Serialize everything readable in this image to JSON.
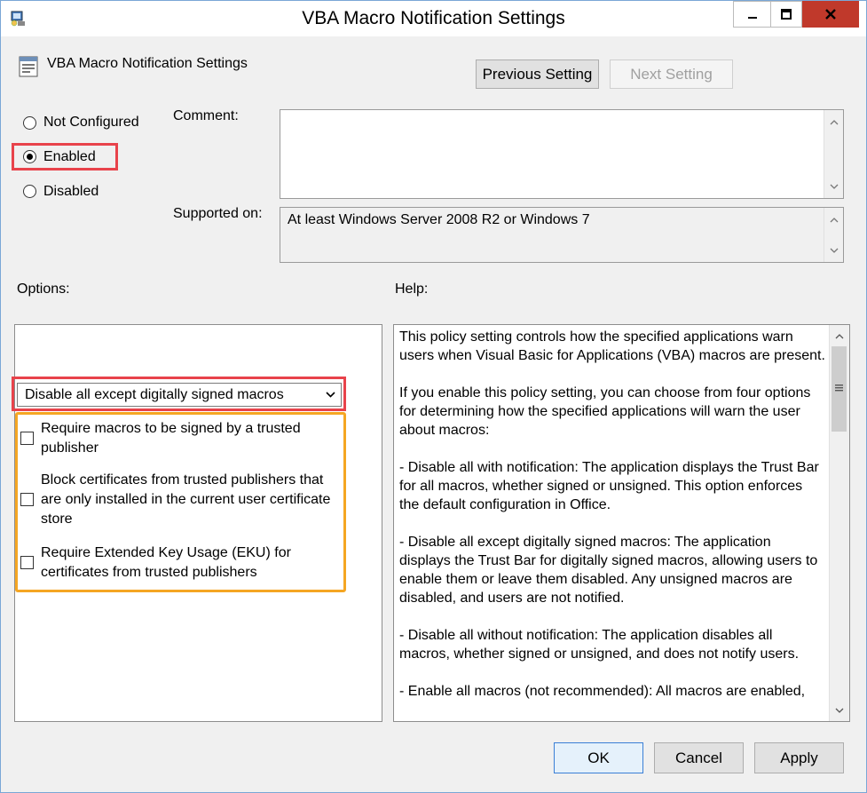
{
  "window": {
    "title": "VBA Macro Notification Settings"
  },
  "header": {
    "setting_name": "VBA Macro Notification Settings",
    "previous_label": "Previous Setting",
    "next_label": "Next Setting"
  },
  "state": {
    "options": [
      "Not Configured",
      "Enabled",
      "Disabled"
    ],
    "selected": "Enabled"
  },
  "comment": {
    "label": "Comment:",
    "value": ""
  },
  "supported": {
    "label": "Supported on:",
    "value": "At least Windows Server 2008 R2 or Windows 7"
  },
  "options_panel": {
    "label": "Options:",
    "dropdown_value": "Disable all except digitally signed macros",
    "checkboxes": [
      {
        "label": "Require macros to be signed by a trusted publisher",
        "checked": false
      },
      {
        "label": "Block certificates from trusted publishers that are only installed in the current user certificate store",
        "checked": false
      },
      {
        "label": "Require Extended Key Usage (EKU) for certificates from trusted publishers",
        "checked": false
      }
    ]
  },
  "help_panel": {
    "label": "Help:",
    "paragraphs": [
      "This policy setting controls how the specified applications warn users when Visual Basic for Applications (VBA) macros are present.",
      "If you enable this policy setting, you can choose from four options for determining how the specified applications will warn the user about macros:",
      "- Disable all with notification:  The application displays the Trust Bar for all macros, whether signed or unsigned. This option enforces the default configuration in Office.",
      "- Disable all except digitally signed macros: The application displays the Trust Bar for digitally signed macros, allowing users to enable them or leave them disabled. Any unsigned macros are disabled, and users are not notified.",
      "- Disable all without notification: The application disables all macros, whether signed or unsigned, and does not notify users.",
      "- Enable all macros (not recommended):  All macros are enabled,"
    ]
  },
  "footer": {
    "ok_label": "OK",
    "cancel_label": "Cancel",
    "apply_label": "Apply"
  },
  "colors": {
    "highlight_red": "#e8434b",
    "highlight_orange": "#f5a623",
    "close_button": "#c0392b"
  }
}
